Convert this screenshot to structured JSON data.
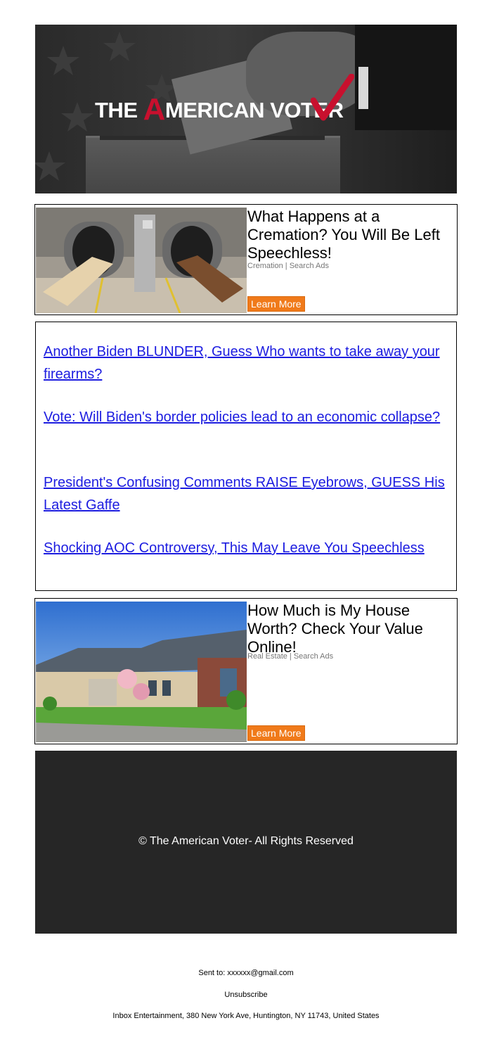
{
  "header": {
    "logo_prefix": "THE ",
    "logo_a": "A",
    "logo_mid": "MERICAN ",
    "logo_v": "V",
    "logo_suffix": "OTER",
    "logo_accent_color": "#c8102e"
  },
  "ads": [
    {
      "headline": "What Happens at a Cremation? You Will Be Left Speechless!",
      "source": "Cremation | Search Ads",
      "button": "Learn More",
      "image": "cremation-furnace-photo"
    },
    {
      "headline": "How Much is My House Worth? Check Your Value Online!",
      "source": "Real Estate | Search Ads",
      "button": "Learn More",
      "image": "suburban-house-photo"
    }
  ],
  "links": [
    "Another Biden BLUNDER, Guess Who wants to take away your firearms?",
    "Vote: Will Biden's border policies lead to an economic collapse?",
    "President's Confusing Comments RAISE Eyebrows, GUESS His Latest Gaffe",
    "Shocking AOC Controversy, This May Leave You Speechless"
  ],
  "footer": {
    "copyright": "© The American Voter- All Rights Reserved"
  },
  "meta": {
    "sent_to": "Sent to: xxxxxx@gmail.com",
    "unsubscribe": "Unsubscribe",
    "address": "Inbox Entertainment, 380 New York Ave, Huntington, NY 11743, United States"
  },
  "colors": {
    "button": "#f07a1a",
    "link": "#1c1ce0",
    "footer_bg": "#262626"
  }
}
